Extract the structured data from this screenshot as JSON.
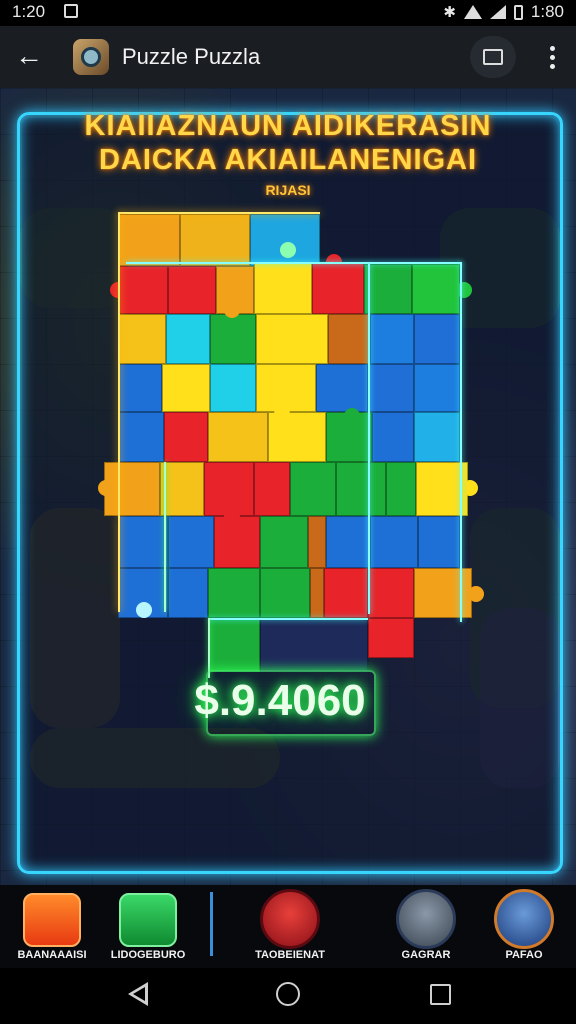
{
  "status_bar": {
    "time_left": "1:20",
    "time_right": "1:80",
    "icons": [
      "notification-icon",
      "bluetooth-icon",
      "wifi-icon",
      "signal-icon",
      "battery-icon"
    ]
  },
  "app_bar": {
    "title": "Puzzle Puzzla",
    "back_icon": "arrow-left-icon",
    "actions": [
      "cast-icon",
      "more-vert-icon"
    ]
  },
  "game": {
    "headline_line1": "KIAIIAZNAUN AIDIKERASIN",
    "headline_line2": "DAICKA AKIAILANENIGAI",
    "sub_label": "RIJASI",
    "score": "$.9.4060",
    "colors": {
      "frame_neon": "#36d6ff",
      "headline": "#ffd84a",
      "score_glow": "#31ff5a"
    }
  },
  "toolbar": {
    "items": [
      {
        "label": "BAANAAAISI",
        "icon": "shop-bag-icon",
        "color": "#ff5a1f"
      },
      {
        "label": "LIDOGEBURO",
        "icon": "leaf-emblem-icon",
        "color": "#19b34a"
      },
      {
        "label": "TAOBEIENAT",
        "icon": "chat-bubble-icon",
        "color": "#c81f2a"
      },
      {
        "label": "GAGRAR",
        "icon": "gear-icon",
        "color": "#6a7888"
      },
      {
        "label": "PAFAO",
        "icon": "mail-icon",
        "color": "#2a6fbf"
      }
    ]
  },
  "nav_bar": {
    "icons": [
      "nav-back-icon",
      "nav-home-icon",
      "nav-recents-icon"
    ]
  }
}
